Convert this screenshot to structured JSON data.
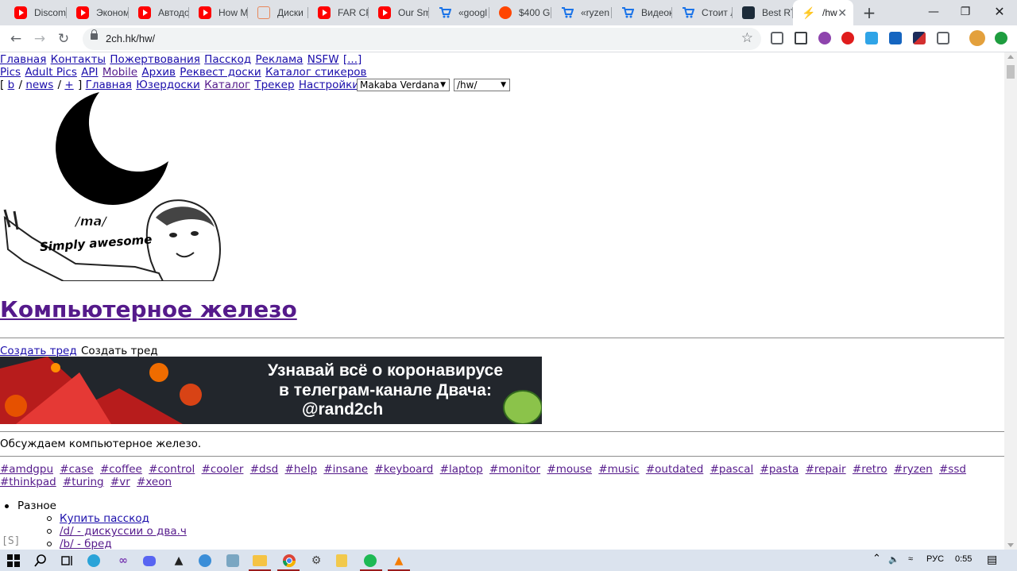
{
  "browser": {
    "tabs": [
      {
        "label": "Discom",
        "icon": "youtube-icon"
      },
      {
        "label": "Эконом",
        "icon": "youtube-icon"
      },
      {
        "label": "Автодо",
        "icon": "youtube-icon"
      },
      {
        "label": "How M",
        "icon": "youtube-icon"
      },
      {
        "label": "Диски",
        "icon": "hdd-icon"
      },
      {
        "label": "FAR CR",
        "icon": "youtube-icon"
      },
      {
        "label": "Our Sm",
        "icon": "youtube-icon"
      },
      {
        "label": "«googl",
        "icon": "cart-icon"
      },
      {
        "label": "$400 G",
        "icon": "reddit-icon"
      },
      {
        "label": "«ryzen",
        "icon": "cart-icon"
      },
      {
        "label": "Видеок",
        "icon": "cart-icon"
      },
      {
        "label": "Стоит л",
        "icon": "cart-icon"
      },
      {
        "label": "Best RT",
        "icon": "pc-icon"
      },
      {
        "label": "/hw",
        "icon": "lightning-icon",
        "active": true
      }
    ],
    "url": "2ch.hk/hw/",
    "colors": {
      "tab_strip": "#dee1e6",
      "youtube": "#ff0000"
    }
  },
  "page": {
    "nav1": [
      "Главная",
      "Контакты",
      "Пожертвования",
      "Пасскод",
      "Реклама",
      "NSFW",
      "[...]"
    ],
    "nav2": [
      "Pics",
      "Adult Pics",
      "API",
      "Mobile",
      "Архив",
      "Реквест доски",
      "Каталог стикеров"
    ],
    "nav3": {
      "open_bracket": "[",
      "boards": [
        "b",
        "news",
        "+"
      ],
      "slash": "/",
      "close_bracket": "]",
      "links": [
        "Главная",
        "Юзердоски",
        "Каталог",
        "Трекер",
        "Настройки"
      ]
    },
    "font_select": "Makaba Verdana",
    "board_select": "/hw/",
    "logo": {
      "caption1": "/ma/",
      "caption2": "Simply awesome"
    },
    "board_title": "Компьютерное железо",
    "create_thread_link": "Создать тред",
    "create_thread_text": "Создать тред",
    "banner": {
      "line1": "Узнавай всё о коронавирусе",
      "line2": "в телеграм-канале Двача:",
      "line3": "@rand2ch"
    },
    "description": "Обсуждаем компьютерное железо.",
    "tags": [
      "#amdgpu",
      "#case",
      "#coffee",
      "#control",
      "#cooler",
      "#dsd",
      "#help",
      "#insane",
      "#keyboard",
      "#laptop",
      "#monitor",
      "#mouse",
      "#music",
      "#outdated",
      "#pascal",
      "#pasta",
      "#repair",
      "#retro",
      "#ryzen",
      "#ssd",
      "#thinkpad",
      "#turing",
      "#vr",
      "#xeon"
    ],
    "menu": {
      "section": "Разное",
      "items": [
        "Купить пасскод",
        "/d/ - дискуссии о два.ч",
        "/b/ - бред"
      ]
    },
    "settings_toggle": "[S]"
  },
  "taskbar": {
    "lang": "РУС",
    "time": "0:55"
  }
}
